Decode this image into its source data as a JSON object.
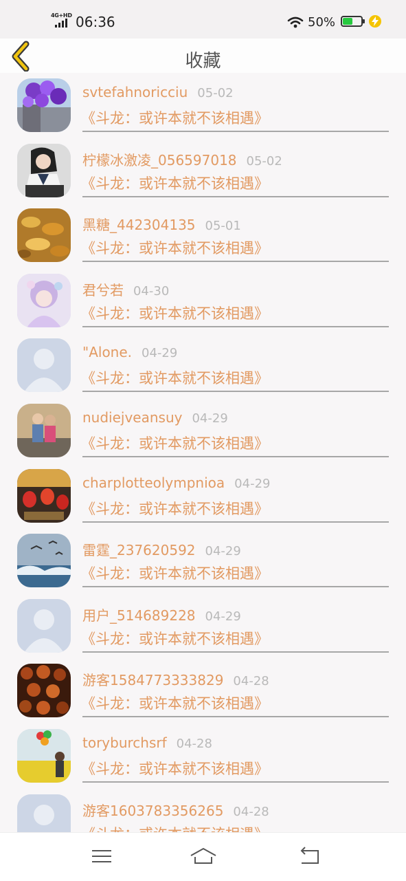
{
  "status_bar": {
    "network_tag": "4G+HD",
    "time": "06:36",
    "battery_percent": "50%",
    "icons": [
      "signal-icon",
      "wifi-icon",
      "battery-icon",
      "charging-icon"
    ]
  },
  "header": {
    "title": "收藏",
    "back_icon": "chevron-left-icon"
  },
  "favorites": [
    {
      "name": "svtefahnoricciu",
      "date": "05-02",
      "story": "《斗龙：或许本就不该相遇》",
      "avatar": "photo-purple-balloons"
    },
    {
      "name": "柠檬冰激凌_056597018",
      "date": "05-02",
      "story": "《斗龙：或许本就不该相遇》",
      "avatar": "photo-girl-uniform"
    },
    {
      "name": "黑糖_442304135",
      "date": "05-01",
      "story": "《斗龙：或许本就不该相遇》",
      "avatar": "photo-autumn-leaves"
    },
    {
      "name": "君兮若",
      "date": "04-30",
      "story": "《斗龙：或许本就不该相遇》",
      "avatar": "photo-anime-girl"
    },
    {
      "name": "\"Alone.",
      "date": "04-29",
      "story": "《斗龙：或许本就不该相遇》",
      "avatar": "default-avatar"
    },
    {
      "name": "nudiejveansuy",
      "date": "04-29",
      "story": "《斗龙：或许本就不该相遇》",
      "avatar": "photo-couple"
    },
    {
      "name": "charplotteolympnioa",
      "date": "04-29",
      "story": "《斗龙：或许本就不该相遇》",
      "avatar": "photo-lanterns"
    },
    {
      "name": "雷霆_237620592",
      "date": "04-29",
      "story": "《斗龙：或许本就不该相遇》",
      "avatar": "photo-seabirds"
    },
    {
      "name": "用户_514689228",
      "date": "04-29",
      "story": "《斗龙：或许本就不该相遇》",
      "avatar": "default-avatar"
    },
    {
      "name": "游客1584773333829",
      "date": "04-28",
      "story": "《斗龙：或许本就不该相遇》",
      "avatar": "photo-food"
    },
    {
      "name": "toryburchsrf",
      "date": "04-28",
      "story": "《斗龙：或许本就不该相遇》",
      "avatar": "photo-flower-field"
    },
    {
      "name": "游客1603783356265",
      "date": "04-28",
      "story": "《斗龙：或许本就不该相遇》",
      "avatar": "default-avatar"
    }
  ],
  "bottom_nav": {
    "icons": [
      "menu-icon",
      "home-icon",
      "back-icon"
    ]
  },
  "colors": {
    "accent_text": "#e29a62",
    "date_text": "#b9b9b9",
    "back_chevron": "#f0c410",
    "battery_fill": "#27c93f",
    "default_avatar_bg": "#cdd6e6"
  }
}
